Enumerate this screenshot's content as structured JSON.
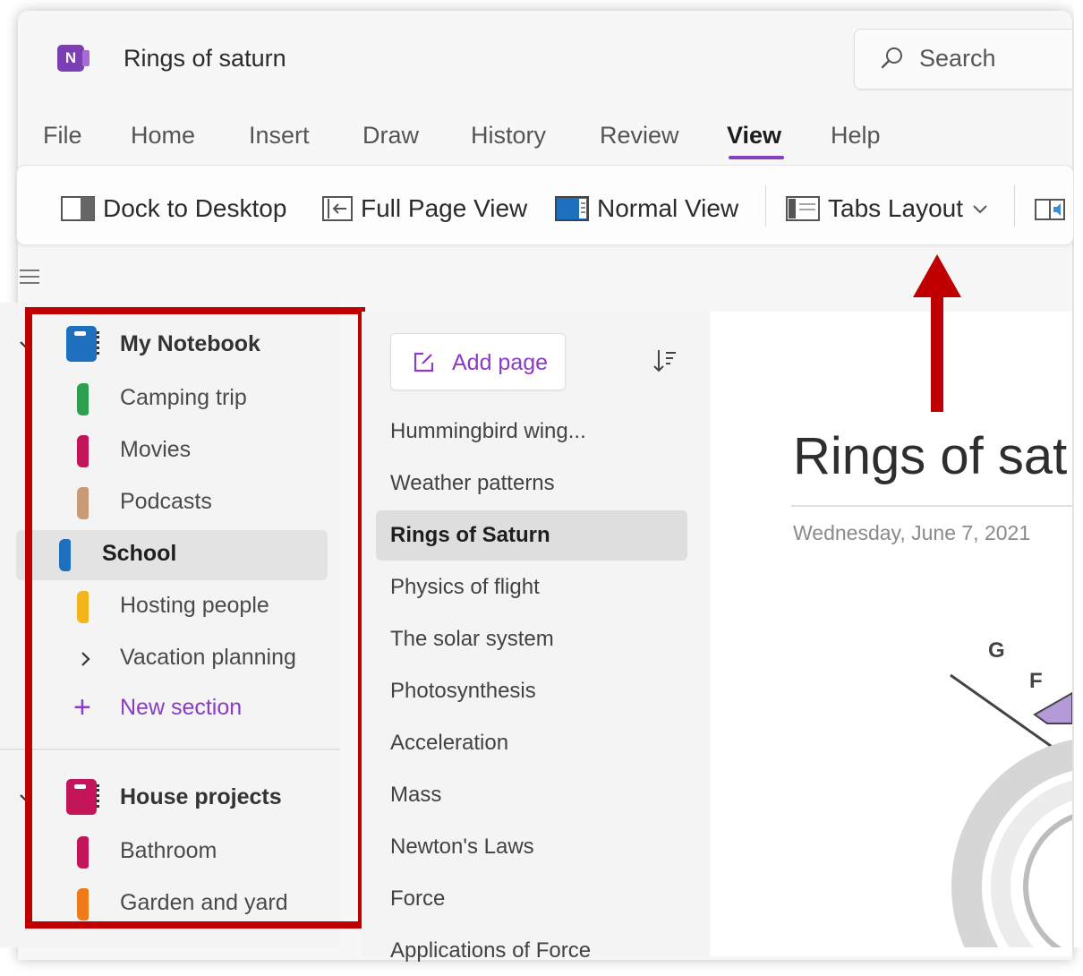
{
  "app": {
    "icon_letter": "N",
    "title": "Rings of saturn"
  },
  "search": {
    "placeholder": "Search"
  },
  "menu": {
    "items": [
      "File",
      "Home",
      "Insert",
      "Draw",
      "History",
      "Review",
      "View",
      "Help"
    ],
    "active": "View"
  },
  "ribbon": {
    "dock_to_desktop": "Dock to Desktop",
    "full_page_view": "Full Page View",
    "normal_view": "Normal View",
    "tabs_layout": "Tabs Layout"
  },
  "notebooks": [
    {
      "name": "My Notebook",
      "color": "#1f6fbf",
      "expanded": true,
      "sections": [
        {
          "name": "Camping trip",
          "color": "#2e9e4f"
        },
        {
          "name": "Movies",
          "color": "#c4145a"
        },
        {
          "name": "Podcasts",
          "color": "#c89a76"
        },
        {
          "name": "School",
          "color": "#1f6fbf",
          "selected": true
        },
        {
          "name": "Hosting people",
          "color": "#f2b51c"
        },
        {
          "name": "Vacation planning",
          "group": true
        }
      ],
      "new_section": "New section"
    },
    {
      "name": "House projects",
      "color": "#c4145a",
      "expanded": true,
      "sections": [
        {
          "name": "Bathroom",
          "color": "#c4145a"
        },
        {
          "name": "Garden and yard",
          "color": "#f07a17"
        }
      ]
    }
  ],
  "pages_pane": {
    "add_page": "Add page",
    "pages": [
      "Hummingbird wing...",
      "Weather patterns",
      "Rings of Saturn",
      "Physics of flight",
      "The solar system",
      "Photosynthesis",
      "Acceleration",
      "Mass",
      "Newton's Laws",
      "Force",
      "Applications of Force"
    ],
    "selected_page": "Rings of Saturn"
  },
  "page": {
    "title": "Rings of sat",
    "date": "Wednesday, June 7, 2021",
    "sketch_letters": [
      "G",
      "F"
    ]
  },
  "annotation": {
    "highlight_color": "#c00000"
  }
}
